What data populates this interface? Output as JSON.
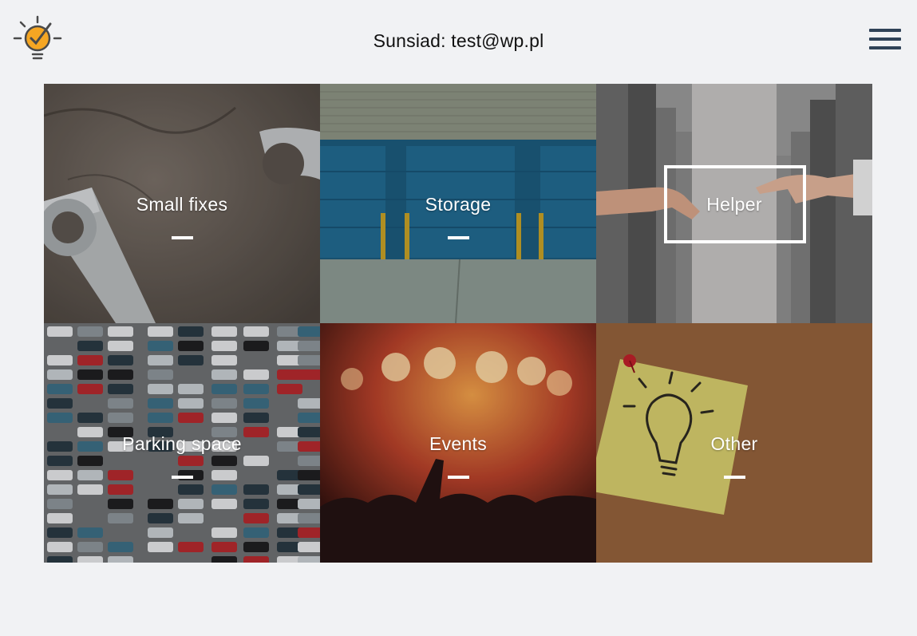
{
  "header": {
    "title": "Sunsiad: test@wp.pl",
    "logo_icon": "lightbulb-check-icon",
    "menu_icon": "hamburger-menu-icon"
  },
  "categories": [
    {
      "label": "Small fixes",
      "image": "wrenches-on-concrete"
    },
    {
      "label": "Storage",
      "image": "blue-garage-doors"
    },
    {
      "label": "Helper",
      "image": "reaching-hands"
    },
    {
      "label": "Parking space",
      "image": "aerial-parking-lot"
    },
    {
      "label": "Events",
      "image": "concert-crowd-lights"
    },
    {
      "label": "Other",
      "image": "sticky-note-lightbulb"
    }
  ],
  "colors": {
    "background": "#f1f2f4",
    "menu": "#2f4257",
    "logo_accent": "#f5a623",
    "label_text": "#ffffff"
  }
}
